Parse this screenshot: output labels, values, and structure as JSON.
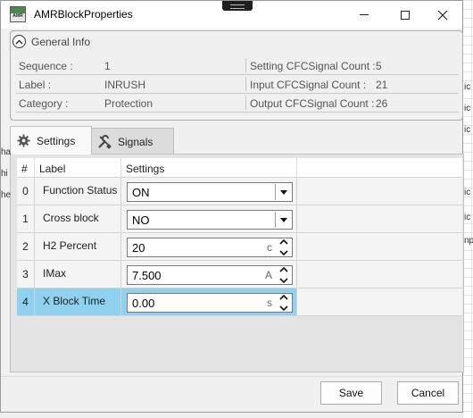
{
  "window": {
    "title": "AMRBlockProperties",
    "icon_text": "AMR"
  },
  "general_info": {
    "title": "General Info",
    "rows": [
      {
        "left_label": "Sequence :",
        "left_value": "1",
        "right_label": "Setting CFCSignal Count :",
        "right_value": "5"
      },
      {
        "left_label": "Label :",
        "left_value": "INRUSH",
        "right_label": "Input CFCSignal Count :",
        "right_value": "21"
      },
      {
        "left_label": "Category :",
        "left_value": "Protection",
        "right_label": "Output CFCSignal Count :",
        "right_value": "26"
      }
    ]
  },
  "tabs": [
    {
      "label": "Settings",
      "icon": "gear-icon",
      "active": true
    },
    {
      "label": "Signals",
      "icon": "tools-icon",
      "active": false
    }
  ],
  "grid": {
    "columns": [
      "#",
      "Label",
      "Settings"
    ],
    "rows": [
      {
        "index": "0",
        "label": "Function Status",
        "type": "combo",
        "value": "ON",
        "unit": ""
      },
      {
        "index": "1",
        "label": "Cross block",
        "type": "combo",
        "value": "NO",
        "unit": ""
      },
      {
        "index": "2",
        "label": "H2 Percent",
        "type": "spin",
        "value": "20",
        "unit": "c"
      },
      {
        "index": "3",
        "label": "IMax",
        "type": "spin",
        "value": "7.500",
        "unit": "A"
      },
      {
        "index": "4",
        "label": "X Block Time",
        "type": "spin",
        "value": "0.00",
        "unit": "s"
      }
    ],
    "selected_row": "4"
  },
  "buttons": {
    "save": "Save",
    "cancel": "Cancel"
  },
  "background_fragments": [
    "ha",
    "hi",
    "he",
    "ic",
    "ic",
    "ic",
    "ic",
    "ic",
    "np"
  ],
  "colors": {
    "selection": "#8fd2f0",
    "window_bg": "#f0f0f0"
  }
}
